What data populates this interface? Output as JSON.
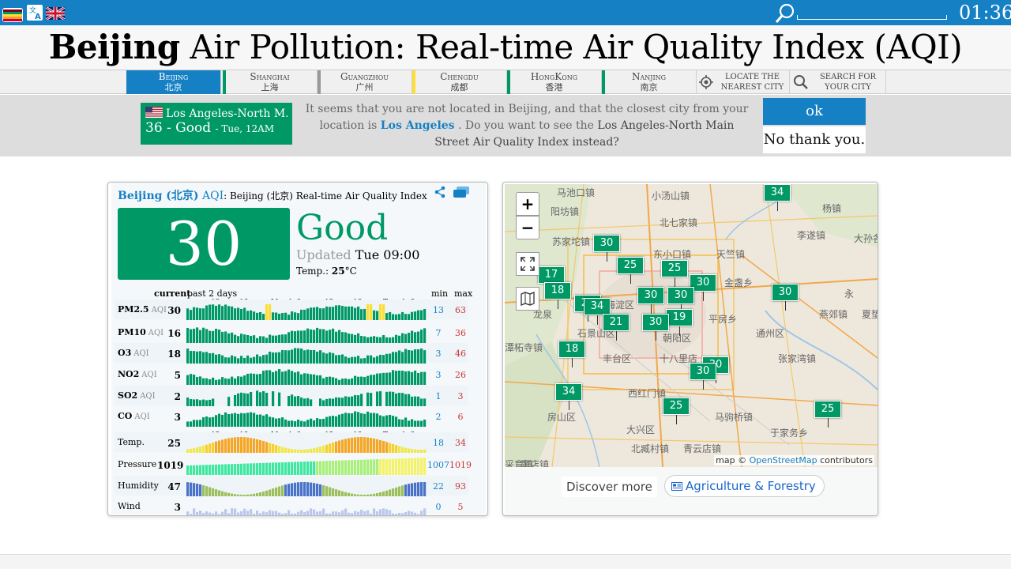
{
  "topbar": {
    "clock": "01:36",
    "icons": [
      "app-logo-icon",
      "translate-icon",
      "uk-flag-icon",
      "search-icon"
    ],
    "search_value": ""
  },
  "title": {
    "bold": "Beijing",
    "rest": " Air Pollution: Real-time Air Quality Index (AQI)"
  },
  "cities": [
    {
      "en": "Beijing",
      "zh": "北京",
      "color": "#1680c4",
      "active": true
    },
    {
      "en": "Shanghai",
      "zh": "上海",
      "color": "#009966"
    },
    {
      "en": "Guangzhou",
      "zh": "广州",
      "color": "#999999"
    },
    {
      "en": "Chengdu",
      "zh": "成都",
      "color": "#ffde33"
    },
    {
      "en": "HongKong",
      "zh": "香港",
      "color": "#009966"
    },
    {
      "en": "Nanjing",
      "zh": "南京",
      "color": "#009966"
    }
  ],
  "tools": {
    "locate_l1": "Locate the",
    "locate_l2": "nearest city",
    "search_l1": "Search for",
    "search_l2": "your city"
  },
  "notice": {
    "la_name": "Los Angeles-North M...",
    "la_value": "36 - Good",
    "la_time": "- Tue, 12AM",
    "text_1": "It seems that you are not located in Beijing, and that the closest city from your location is ",
    "link": "Los Angeles",
    "text_2": " . Do you want to see the ",
    "text_3": "Los Angeles-North Main Street",
    "text_4": " Air Quality Index instead?",
    "ok": "ok",
    "no": "No thank you."
  },
  "card": {
    "title_city": "Beijing (北京)",
    "title_aqi": " AQI",
    "title_rest": ": Beijing (北京) Real-time Air Quality Index",
    "aqi": "30",
    "level": "Good",
    "updated_label": "Updated",
    "updated_time": "Tue 09:00",
    "temp_label": "Temp.:",
    "temp_value": "25",
    "temp_unit": "°C",
    "hdr_current": "current",
    "hdr_past": "past 2 days",
    "hdr_min": "min",
    "hdr_max": "max",
    "ticks": [
      "12",
      "18",
      "Monday",
      "6",
      "12",
      "18",
      "Tuesday",
      "6"
    ],
    "rows": [
      {
        "name": "PM2.5",
        "sub": "AQI",
        "cur": "30",
        "min": "13",
        "max": "63"
      },
      {
        "name": "PM10",
        "sub": "AQI",
        "cur": "16",
        "min": "7",
        "max": "36"
      },
      {
        "name": "O3",
        "sub": "AQI",
        "cur": "18",
        "min": "3",
        "max": "46"
      },
      {
        "name": "NO2",
        "sub": "AQI",
        "cur": "5",
        "min": "3",
        "max": "26"
      },
      {
        "name": "SO2",
        "sub": "AQI",
        "cur": "2",
        "min": "1",
        "max": "3"
      },
      {
        "name": "CO",
        "sub": "AQI",
        "cur": "3",
        "min": "2",
        "max": "6"
      },
      {
        "name": "Temp.",
        "sub": "",
        "cur": "25",
        "min": "18",
        "max": "34"
      },
      {
        "name": "Pressure",
        "sub": "",
        "cur": "1019",
        "min": "1007",
        "max": "1019"
      },
      {
        "name": "Humidity",
        "sub": "",
        "cur": "47",
        "min": "22",
        "max": "93"
      },
      {
        "name": "Wind",
        "sub": "",
        "cur": "3",
        "min": "0",
        "max": "5"
      }
    ]
  },
  "map": {
    "zoom_in": "+",
    "zoom_out": "−",
    "attrib_pre": "map © ",
    "attrib_link": "OpenStreetMap",
    "attrib_post": " contributors",
    "discover": "Discover more",
    "agri": "Agriculture & Forestry",
    "places": [
      "马池口镇",
      "小汤山镇",
      "阳坊镇",
      "北七家镇",
      "杨镇",
      "苏家坨镇",
      "李遂镇",
      "大孙各",
      "东小口镇",
      "天竺镇",
      "金盏乡",
      "海淀区",
      "平房乡",
      "燕郊镇",
      "石景山区",
      "朝阳区",
      "通州区",
      "潭柘寺镇",
      "丰台区",
      "张家湾镇",
      "十八里店",
      "西红门镇",
      "马驹桥镇",
      "房山区",
      "大兴区",
      "于家务乡",
      "采育镇",
      "北臧村镇",
      "青云店镇",
      "窦店镇",
      "龙泉",
      "夏垫",
      "永"
    ],
    "markers": [
      "34",
      "30",
      "25",
      "25",
      "30",
      "17",
      "18",
      "21",
      "30",
      "34",
      "30",
      "19",
      "21",
      "30",
      "30",
      "18",
      "30",
      "30",
      "34",
      "25",
      "25"
    ]
  },
  "colors": {
    "good": "#009966",
    "moderate": "#ffde33",
    "brand": "#1680c4"
  }
}
